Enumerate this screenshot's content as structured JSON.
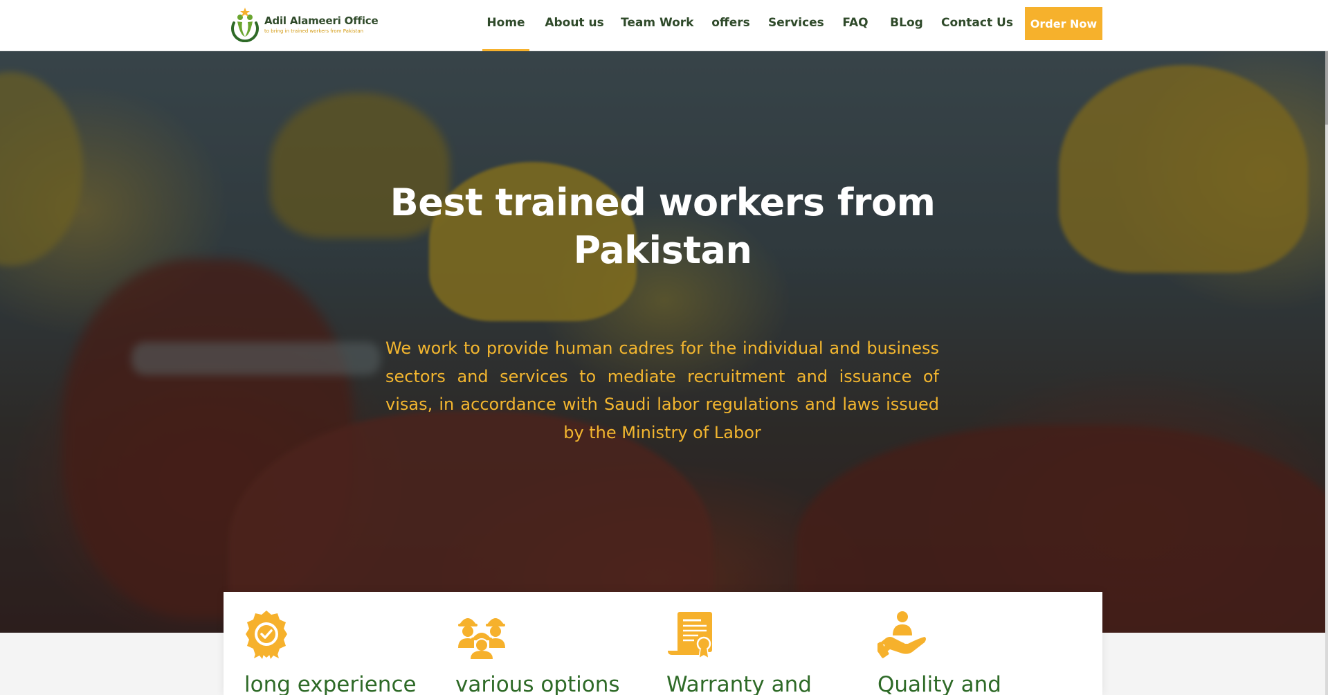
{
  "brand": {
    "name": "Adil Alameeri Office",
    "tagline": "to bring in trained workers from Pakistan",
    "accent": "#f6b12c",
    "green": "#2f4a2a"
  },
  "nav": {
    "items": [
      {
        "label": "Home",
        "active": true
      },
      {
        "label": "About us"
      },
      {
        "label": "Team Work"
      },
      {
        "label": "offers"
      },
      {
        "label": "Services"
      },
      {
        "label": "FAQ"
      },
      {
        "label": "BLog"
      },
      {
        "label": "Contact Us"
      }
    ],
    "order_label": "Order Now"
  },
  "hero": {
    "title": "Best trained workers from Pakistan",
    "subtitle": "We work to provide human cadres for the individual and business sectors and services to mediate recruitment and issuance of visas, in accordance with Saudi labor regulations and laws issued by the Ministry of Labor"
  },
  "features": [
    {
      "title": "long experience",
      "icon": "award-badge-icon"
    },
    {
      "title": "various options",
      "icon": "workers-group-icon"
    },
    {
      "title": "Warranty and",
      "icon": "certificate-icon"
    },
    {
      "title": "Quality and",
      "icon": "hand-care-icon"
    }
  ]
}
